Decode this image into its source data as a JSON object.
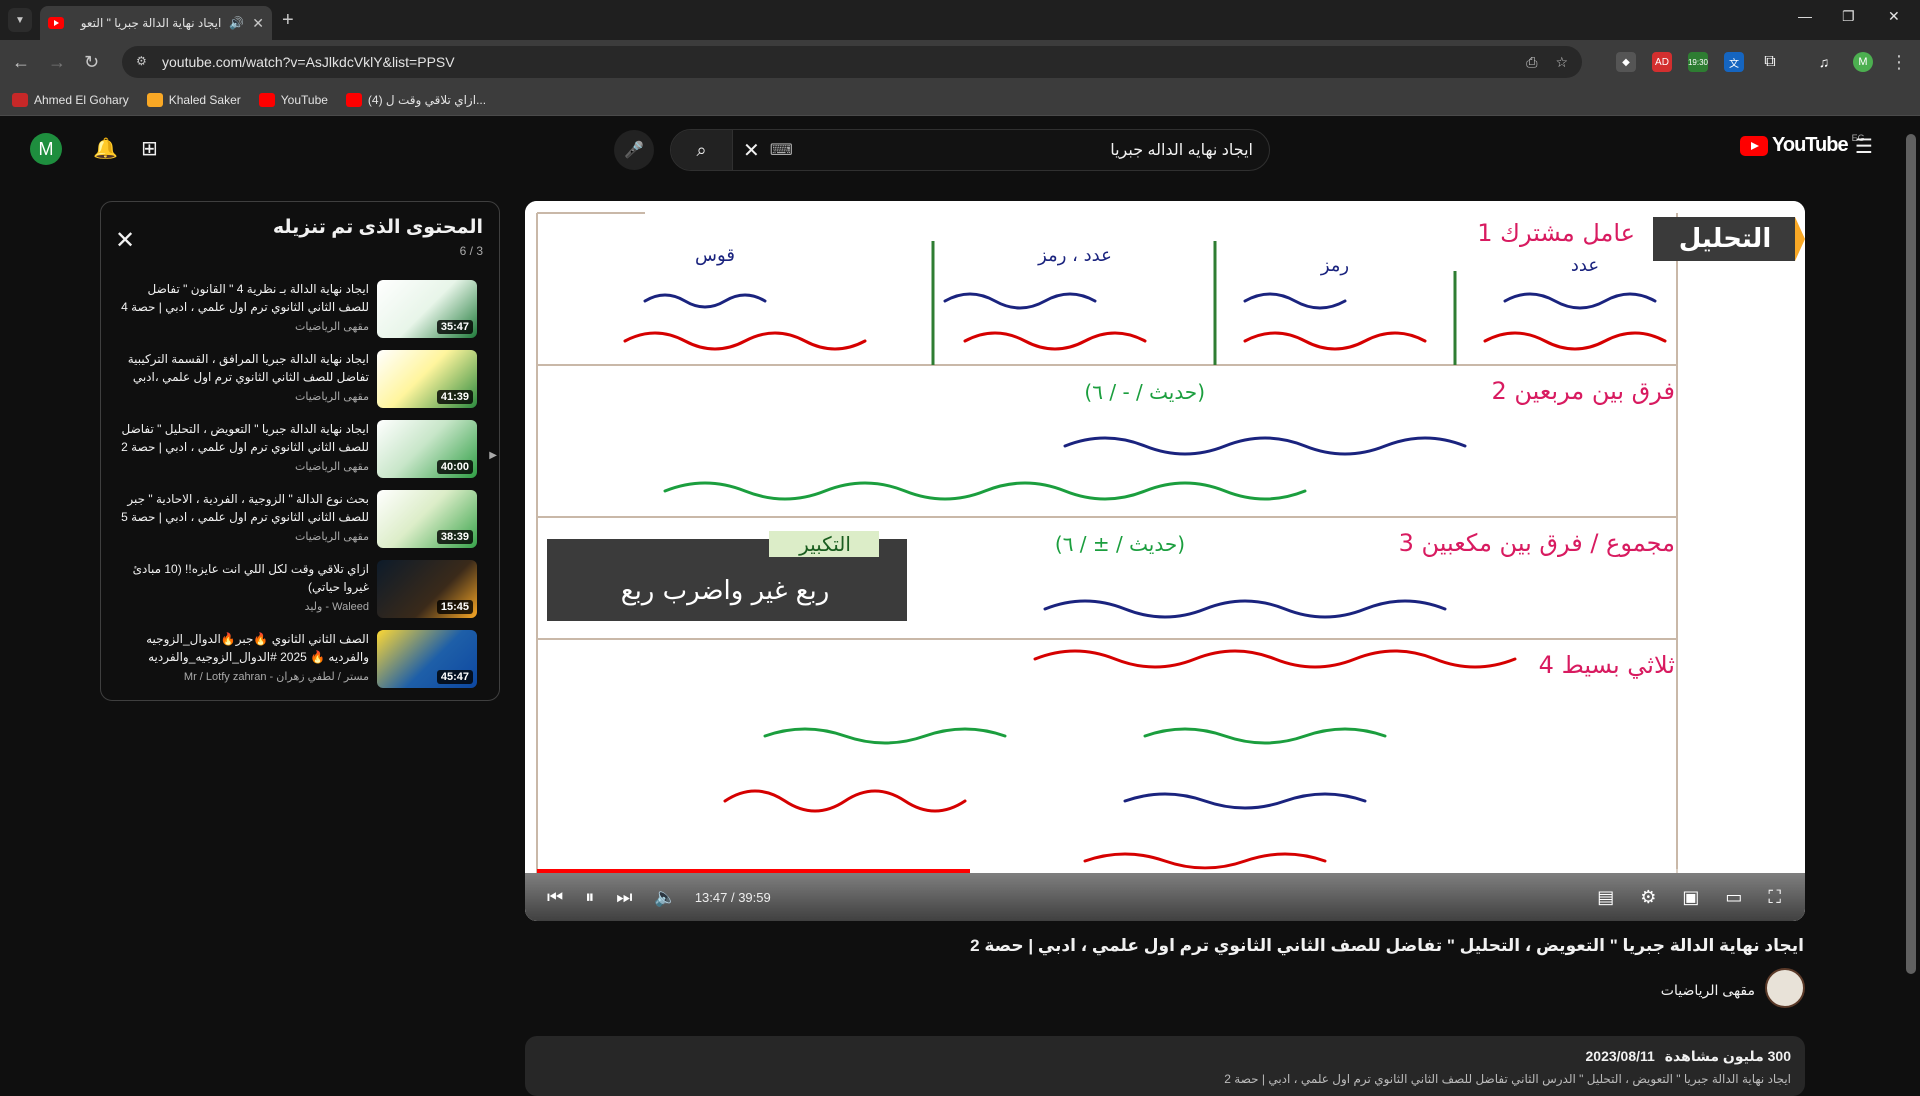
{
  "browser": {
    "tab_title": "ايجاد نهاية الدالة جبريا \" التعو",
    "url": "youtube.com/watch?v=AsJlkdcVklY&list=PPSV",
    "bookmarks": [
      {
        "label": "Ahmed El Gohary",
        "color": "#c62828"
      },
      {
        "label": "Khaled Saker",
        "color": "#f9a825"
      },
      {
        "label": "YouTube",
        "color": "#ff0000"
      },
      {
        "label": "(4) ازاي تلاقي وقت ل...",
        "color": "#ff0000"
      }
    ],
    "extension_badge": "19:30",
    "profile_initial": "M"
  },
  "masthead": {
    "avatar_initial": "M",
    "search_value": "ايجاد نهايه الداله جبريا",
    "logo_text": "YouTube",
    "country": "EG"
  },
  "downloads": {
    "title": "المحتوى الذى تم تنزيله",
    "count": "6 / 3",
    "items": [
      {
        "title": "ايجاد نهاية الدالة بـ نظرية 4 \" القانون \" تفاضل للصف الثاني الثانوي ترم اول علمي ، ادبي | حصة 4",
        "channel": "مقهى الرياضيات",
        "duration": "35:47",
        "thumb_color": "#1f7a3a"
      },
      {
        "title": "ايجاد نهاية الدالة جبريا المرافق ، القسمة التركيبية تفاضل للصف الثاني الثانوي ترم اول علمي ،ادبي ح3",
        "channel": "مقهى الرياضيات",
        "duration": "41:39",
        "thumb_color": "#2b8a3e"
      },
      {
        "title": "ايجاد نهاية الدالة جبريا \" التعويض ، التحليل \" تفاضل للصف الثاني الثانوي ترم اول علمي ، ادبي | حصة 2",
        "channel": "مقهى الرياضيات",
        "duration": "40:00",
        "thumb_color": "#2f9e44"
      },
      {
        "title": "بحث نوع الدالة \" الزوجية ، الفردية ، الاحادية \" جبر للصف الثاني الثانوي ترم اول علمي ، ادبي | حصة 5",
        "channel": "مقهى الرياضيات",
        "duration": "38:39",
        "thumb_color": "#37a34a"
      },
      {
        "title": "ازاي تلاقي وقت لكل اللي انت عايزه!! (10 مبادئ غيروا حياتي)",
        "channel": "Waleed - وليد",
        "duration": "15:45",
        "thumb_color": "#1b2a3a"
      },
      {
        "title": "الصف الثاني الثانوي 🔥جبر🔥الدوال_الزوجيه والفرديه 🔥 2025 #الدوال_الزوجيه_والفرديه",
        "channel": "مستر / لطفي زهران - Mr / Lotfy zahran",
        "duration": "45:47",
        "thumb_color": "#1e5fa8"
      }
    ]
  },
  "player": {
    "time": "13:47 / 39:59",
    "progress": 0.345,
    "board": {
      "tag": "التحليل",
      "sections": [
        {
          "label": "1 عامل مشترك",
          "color": "#d81b60"
        },
        {
          "label": "2 فرق بين مربعين",
          "color": "#d81b60"
        },
        {
          "label": "3 مجموع / فرق بين مكعبين",
          "color": "#d81b60"
        },
        {
          "label": "4 ثلاثي بسيط",
          "color": "#d81b60"
        }
      ],
      "tip_label": "التكبير",
      "tip_text": "ربع غير واضرب ربع",
      "col_labels": [
        "عدد",
        "رمز",
        "عدد ، رمز",
        "قوس"
      ],
      "hint": "(حديث / - / ٦)",
      "cube_hint": "(حديث / ± / ٦)"
    }
  },
  "video": {
    "title": "ايجاد نهاية الدالة جبريا \" التعويض ، التحليل \" تفاضل للصف الثاني الثانوي ترم اول علمي ، ادبي | حصة 2",
    "channel": "مقهى الرياضيات",
    "views": "300 مليون مشاهدة",
    "date": "2023/08/11",
    "description_line": "ايجاد نهاية الدالة جبريا \" التعويض ، التحليل \" الدرس الثاني تفاضل للصف الثاني الثانوي ترم اول علمي ، ادبي | حصة 2"
  }
}
